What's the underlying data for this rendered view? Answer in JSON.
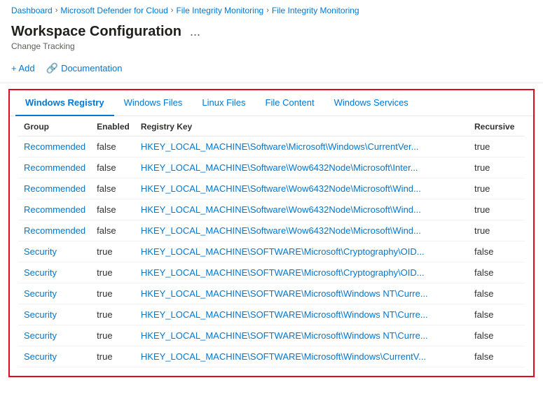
{
  "breadcrumb": {
    "items": [
      {
        "label": "Dashboard",
        "link": true
      },
      {
        "label": "Microsoft Defender for Cloud",
        "link": true
      },
      {
        "label": "File Integrity Monitoring",
        "link": true
      },
      {
        "label": "File Integrity Monitoring",
        "link": true
      }
    ]
  },
  "header": {
    "title": "Workspace Configuration",
    "ellipsis": "...",
    "subtitle": "Change Tracking"
  },
  "toolbar": {
    "add_label": "+ Add",
    "documentation_label": "Documentation"
  },
  "tabs": [
    {
      "label": "Windows Registry",
      "active": true
    },
    {
      "label": "Windows Files",
      "active": false
    },
    {
      "label": "Linux Files",
      "active": false
    },
    {
      "label": "File Content",
      "active": false
    },
    {
      "label": "Windows Services",
      "active": false
    }
  ],
  "table": {
    "columns": [
      "Group",
      "Enabled",
      "Registry Key",
      "Recursive"
    ],
    "rows": [
      {
        "group": "Recommended",
        "enabled": "false",
        "key": "HKEY_LOCAL_MACHINE\\Software\\Microsoft\\Windows\\CurrentVer...",
        "recursive": "true"
      },
      {
        "group": "Recommended",
        "enabled": "false",
        "key": "HKEY_LOCAL_MACHINE\\Software\\Wow6432Node\\Microsoft\\Inter...",
        "recursive": "true"
      },
      {
        "group": "Recommended",
        "enabled": "false",
        "key": "HKEY_LOCAL_MACHINE\\Software\\Wow6432Node\\Microsoft\\Wind...",
        "recursive": "true"
      },
      {
        "group": "Recommended",
        "enabled": "false",
        "key": "HKEY_LOCAL_MACHINE\\Software\\Wow6432Node\\Microsoft\\Wind...",
        "recursive": "true"
      },
      {
        "group": "Recommended",
        "enabled": "false",
        "key": "HKEY_LOCAL_MACHINE\\Software\\Wow6432Node\\Microsoft\\Wind...",
        "recursive": "true"
      },
      {
        "group": "Security",
        "enabled": "true",
        "key": "HKEY_LOCAL_MACHINE\\SOFTWARE\\Microsoft\\Cryptography\\OID...",
        "recursive": "false"
      },
      {
        "group": "Security",
        "enabled": "true",
        "key": "HKEY_LOCAL_MACHINE\\SOFTWARE\\Microsoft\\Cryptography\\OID...",
        "recursive": "false"
      },
      {
        "group": "Security",
        "enabled": "true",
        "key": "HKEY_LOCAL_MACHINE\\SOFTWARE\\Microsoft\\Windows NT\\Curre...",
        "recursive": "false"
      },
      {
        "group": "Security",
        "enabled": "true",
        "key": "HKEY_LOCAL_MACHINE\\SOFTWARE\\Microsoft\\Windows NT\\Curre...",
        "recursive": "false"
      },
      {
        "group": "Security",
        "enabled": "true",
        "key": "HKEY_LOCAL_MACHINE\\SOFTWARE\\Microsoft\\Windows NT\\Curre...",
        "recursive": "false"
      },
      {
        "group": "Security",
        "enabled": "true",
        "key": "HKEY_LOCAL_MACHINE\\SOFTWARE\\Microsoft\\Windows\\CurrentV...",
        "recursive": "false"
      }
    ]
  }
}
